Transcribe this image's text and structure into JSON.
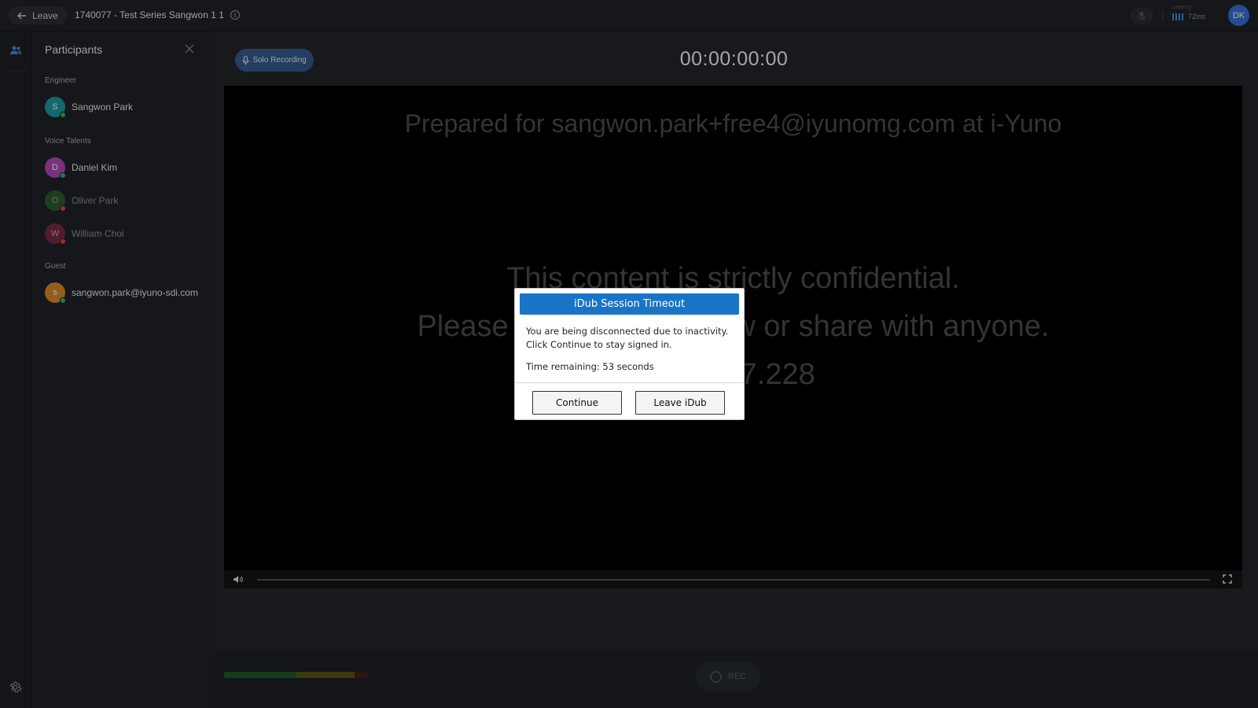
{
  "header": {
    "leave_label": "Leave",
    "session_title": "1740077 - Test Series Sangwon 1 1",
    "latency_label": "Latency",
    "latency_value": "72ms",
    "user_initials": "DK"
  },
  "panel": {
    "title": "Participants",
    "groups": [
      {
        "label": "Engineer",
        "participants": [
          {
            "initial": "S",
            "name": "Sangwon Park",
            "avatar_color": "#1f9aa0",
            "status": "online"
          }
        ]
      },
      {
        "label": "Voice Talents",
        "participants": [
          {
            "initial": "D",
            "name": "Daniel Kim",
            "avatar_color": "#b04ab8",
            "status": "online"
          },
          {
            "initial": "O",
            "name": "Oliver Park",
            "avatar_color": "#2f5a30",
            "status": "offline"
          },
          {
            "initial": "W",
            "name": "William Choi",
            "avatar_color": "#7a2a47",
            "status": "offline"
          }
        ]
      },
      {
        "label": "Guest",
        "participants": [
          {
            "initial": "s",
            "name": "sangwon.park@iyuno-sdi.com",
            "avatar_color": "#d98a2b",
            "status": "online"
          }
        ]
      }
    ]
  },
  "main": {
    "solo_recording_label": "Solo Recording",
    "timer": "00:00:00:00",
    "watermark_top": "Prepared for sangwon.park+free4@iyunomg.com at i-Yuno",
    "watermark_line1": "This content is strictly confidential.",
    "watermark_line2": "Please do not copy, show or share with anyone.",
    "watermark_line3": "211.247.228",
    "playback_progress": 0,
    "rec_label": "REC"
  },
  "dialog": {
    "title": "iDub Session Timeout",
    "message_line1": "You are being disconnected due to inactivity.",
    "message_line2": "Click Continue to stay signed in.",
    "time_remaining": "Time remaining: 53 seconds",
    "continue_label": "Continue",
    "leave_label": "Leave iDub"
  },
  "colors": {
    "accent": "#1a74c6",
    "solo_button": "#365b8f",
    "status_online": "#2fb86a",
    "status_offline": "#d8473c",
    "avatar_dk": "#3a6fd6"
  }
}
